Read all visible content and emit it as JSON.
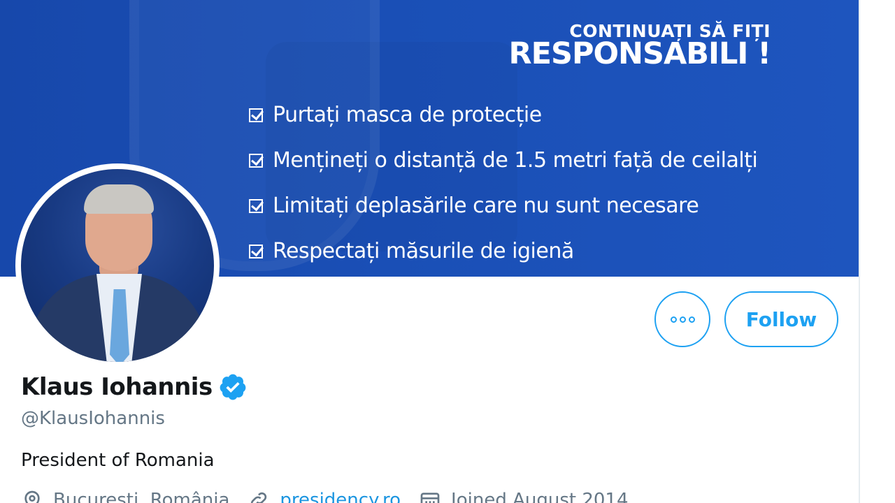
{
  "banner": {
    "heading_line1": "CONTINUAȚI SĂ FIȚI",
    "heading_line2": "RESPONSABILI !",
    "items": [
      "Purtați masca de protecție",
      "Mențineți o distanță de 1.5 metri față de ceilalți",
      "Limitați deplasările care nu sunt necesare",
      "Respectați măsurile de igienă"
    ],
    "color": "#1a4fb6"
  },
  "profile": {
    "name": "Klaus Iohannis",
    "handle": "@KlausIohannis",
    "bio": "President of Romania",
    "verified_icon": "verified-badge-icon",
    "location": "București, România",
    "website": "presidency.ro",
    "joined": "Joined August 2014"
  },
  "actions": {
    "more_icon": "more-options-icon",
    "follow_label": "Follow"
  },
  "colors": {
    "accent": "#1da1f2",
    "text": "#14171a",
    "secondary_text": "#657786"
  }
}
